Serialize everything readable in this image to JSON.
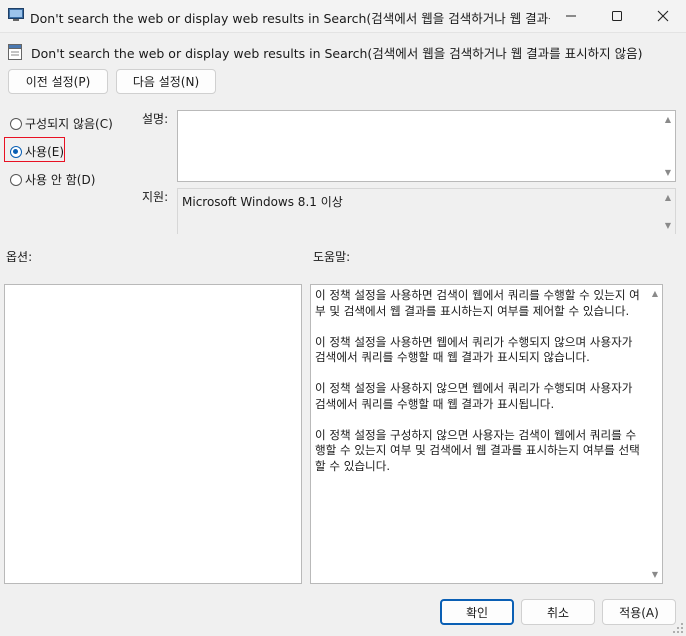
{
  "window": {
    "title": "Don't search the web or display web results in Search(검색에서 웹을 검색하거나 웹 결과를 표시...",
    "header": "Don't search the web or display web results in Search(검색에서 웹을 검색하거나 웹 결과를 표시하지 않음)"
  },
  "nav": {
    "prev_label": "이전 설정(P)",
    "next_label": "다음 설정(N)"
  },
  "radios": [
    {
      "label": "구성되지 않음(C)",
      "checked": false
    },
    {
      "label": "사용(E)",
      "checked": true
    },
    {
      "label": "사용 안 함(D)",
      "checked": false
    }
  ],
  "comment_label": "설명:",
  "comment_value": "",
  "supported_label": "지원:",
  "supported_value": "Microsoft Windows 8.1 이상",
  "options_label": "옵션:",
  "help_label": "도움말:",
  "help_text": "이 정책 설정을 사용하면 검색이 웹에서 쿼리를 수행할 수 있는지 여부 및 검색에서 웹 결과를 표시하는지 여부를 제어할 수 있습니다.\n\n이 정책 설정을 사용하면 웹에서 쿼리가 수행되지 않으며 사용자가 검색에서 쿼리를 수행할 때 웹 결과가 표시되지 않습니다.\n\n이 정책 설정을 사용하지 않으면 웹에서 쿼리가 수행되며 사용자가 검색에서 쿼리를 수행할 때 웹 결과가 표시됩니다.\n\n이 정책 설정을 구성하지 않으면 사용자는 검색이 웹에서 쿼리를 수행할 수 있는지 여부 및 검색에서 웹 결과를 표시하는지 여부를 선택할 수 있습니다.",
  "footer": {
    "ok_label": "확인",
    "cancel_label": "취소",
    "apply_label": "적용(A)"
  },
  "colors": {
    "accent": "#0a5fb4",
    "highlight_border": "#e81123"
  }
}
